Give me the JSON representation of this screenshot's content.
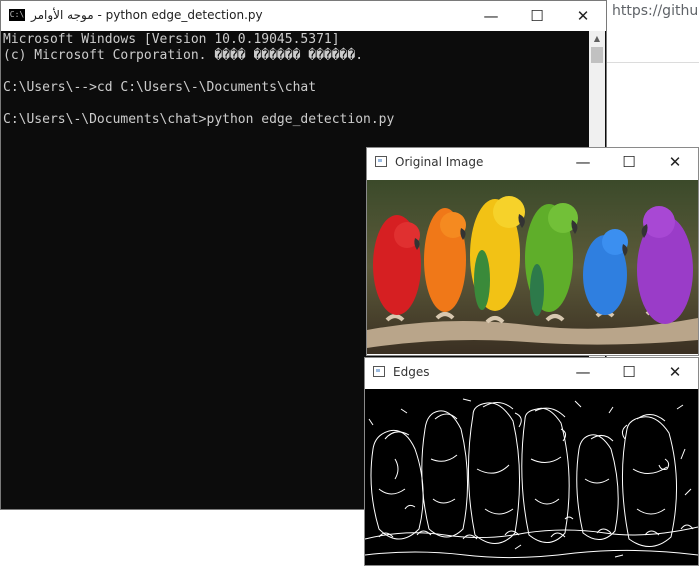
{
  "browser": {
    "url_fragment": "https://github"
  },
  "console": {
    "title": "موجه الأوامر - python  edge_detection.py",
    "app_icon": "C:\\",
    "lines": [
      "Microsoft Windows [Version 10.0.19045.5371]",
      "(c) Microsoft Corporation. ���� ������ ������.",
      "",
      "C:\\Users\\-->cd C:\\Users\\-\\Documents\\chat",
      "",
      "C:\\Users\\-\\Documents\\chat>python edge_detection.py"
    ],
    "buttons": {
      "minimize": "—",
      "maximize": "☐",
      "close": "✕"
    }
  },
  "original_window": {
    "title": "Original Image",
    "buttons": {
      "minimize": "—",
      "maximize": "☐",
      "close": "✕"
    }
  },
  "edges_window": {
    "title": "Edges",
    "buttons": {
      "minimize": "—",
      "maximize": "☐",
      "close": "✕"
    }
  },
  "colors": {
    "console_bg": "#0c0c0c",
    "console_text": "#cccccc",
    "parrots": [
      "#d61f22",
      "#f07818",
      "#f2c215",
      "#5fae2a",
      "#2f7fe0",
      "#9a3cc8"
    ]
  }
}
